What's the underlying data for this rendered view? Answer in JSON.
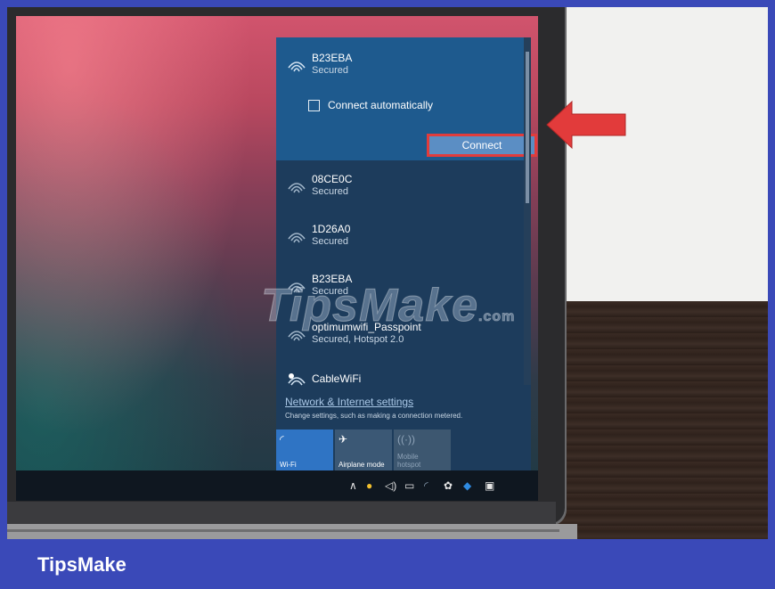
{
  "selected_network": {
    "ssid": "B23EBA",
    "status": "Secured",
    "connect_automatically_label": "Connect automatically",
    "connect_automatically_checked": false,
    "connect_button_label": "Connect"
  },
  "networks": [
    {
      "ssid": "08CE0C",
      "status": "Secured",
      "icon": "wifi-secured-icon"
    },
    {
      "ssid": "1D26A0",
      "status": "Secured",
      "icon": "wifi-secured-icon"
    },
    {
      "ssid": "B23EBA",
      "status": "Secured",
      "icon": "wifi-secured-icon"
    },
    {
      "ssid": "optimumwifi_Passpoint",
      "status": "Secured, Hotspot 2.0",
      "icon": "wifi-secured-icon"
    },
    {
      "ssid": "CableWiFi",
      "status": "",
      "icon": "wifi-open-icon"
    }
  ],
  "settings": {
    "link_label": "Network & Internet settings",
    "description": "Change settings, such as making a connection metered."
  },
  "quick_actions": [
    {
      "label": "Wi-Fi",
      "icon": "wifi-icon",
      "active": true
    },
    {
      "label": "Airplane mode",
      "icon": "airplane-icon",
      "active": false
    },
    {
      "label": "Mobile hotspot",
      "icon": "hotspot-icon",
      "active": false,
      "disabled": true
    }
  ],
  "taskbar": {
    "tray_icons": [
      "chevron-up-icon",
      "app-icon",
      "volume-icon",
      "battery-icon",
      "network-icon",
      "settings-icon",
      "dropbox-icon",
      "notification-icon"
    ]
  },
  "watermark": {
    "text": "TipsMake",
    "suffix": ".com"
  },
  "brand": {
    "name": "TipsMake"
  },
  "colors": {
    "accent": "#1e5a8e",
    "highlight": "#e13c3c",
    "brand_bar": "#3a49b8",
    "active_tile": "#2f74c4"
  }
}
